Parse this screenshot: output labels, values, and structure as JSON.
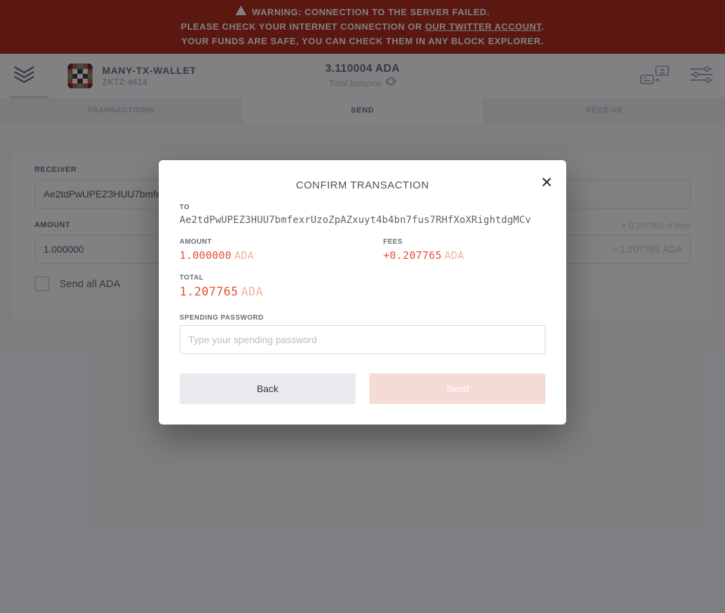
{
  "warning": {
    "line1": "WARNING: CONNECTION TO THE SERVER FAILED.",
    "line2_prefix": "PLEASE CHECK YOUR INTERNET CONNECTION OR ",
    "line2_link": "OUR TWITTER ACCOUNT",
    "line2_suffix": ".",
    "line3": "YOUR FUNDS ARE SAFE, YOU CAN CHECK THEM IN ANY BLOCK EXPLORER."
  },
  "header": {
    "wallet_name": "MANY-TX-WALLET",
    "wallet_id": "ZKTZ-4614",
    "balance": "3.110004 ADA",
    "balance_label": "Total balance"
  },
  "tabs": {
    "transactions": "TRANSACTIONS",
    "send": "SEND",
    "receive": "RECEIVE"
  },
  "send_form": {
    "receiver_label": "RECEIVER",
    "receiver_value": "Ae2tdPwUPEZ3HUU7bmfe",
    "amount_label": "AMOUNT",
    "amount_value": "1.000000",
    "fees_hint": "+ 0.207765 of fees",
    "amount_total": "= 1.207765 ADA",
    "send_all": "Send all ADA"
  },
  "modal": {
    "title": "CONFIRM TRANSACTION",
    "to_label": "TO",
    "to_address": "Ae2tdPwUPEZ3HUU7bmfexrUzoZpAZxuyt4b4bn7fus7RHfXoXRightdgMCv",
    "amount_label": "AMOUNT",
    "amount_value": "1.000000",
    "amount_unit": "ADA",
    "fees_label": "FEES",
    "fees_value": "+0.207765",
    "fees_unit": "ADA",
    "total_label": "TOTAL",
    "total_value": "1.207765",
    "total_unit": "ADA",
    "pw_label": "SPENDING PASSWORD",
    "pw_placeholder": "Type your spending password",
    "back": "Back",
    "send": "Send"
  },
  "colors": {
    "danger": "#ab1700",
    "accent": "#e84d37"
  }
}
